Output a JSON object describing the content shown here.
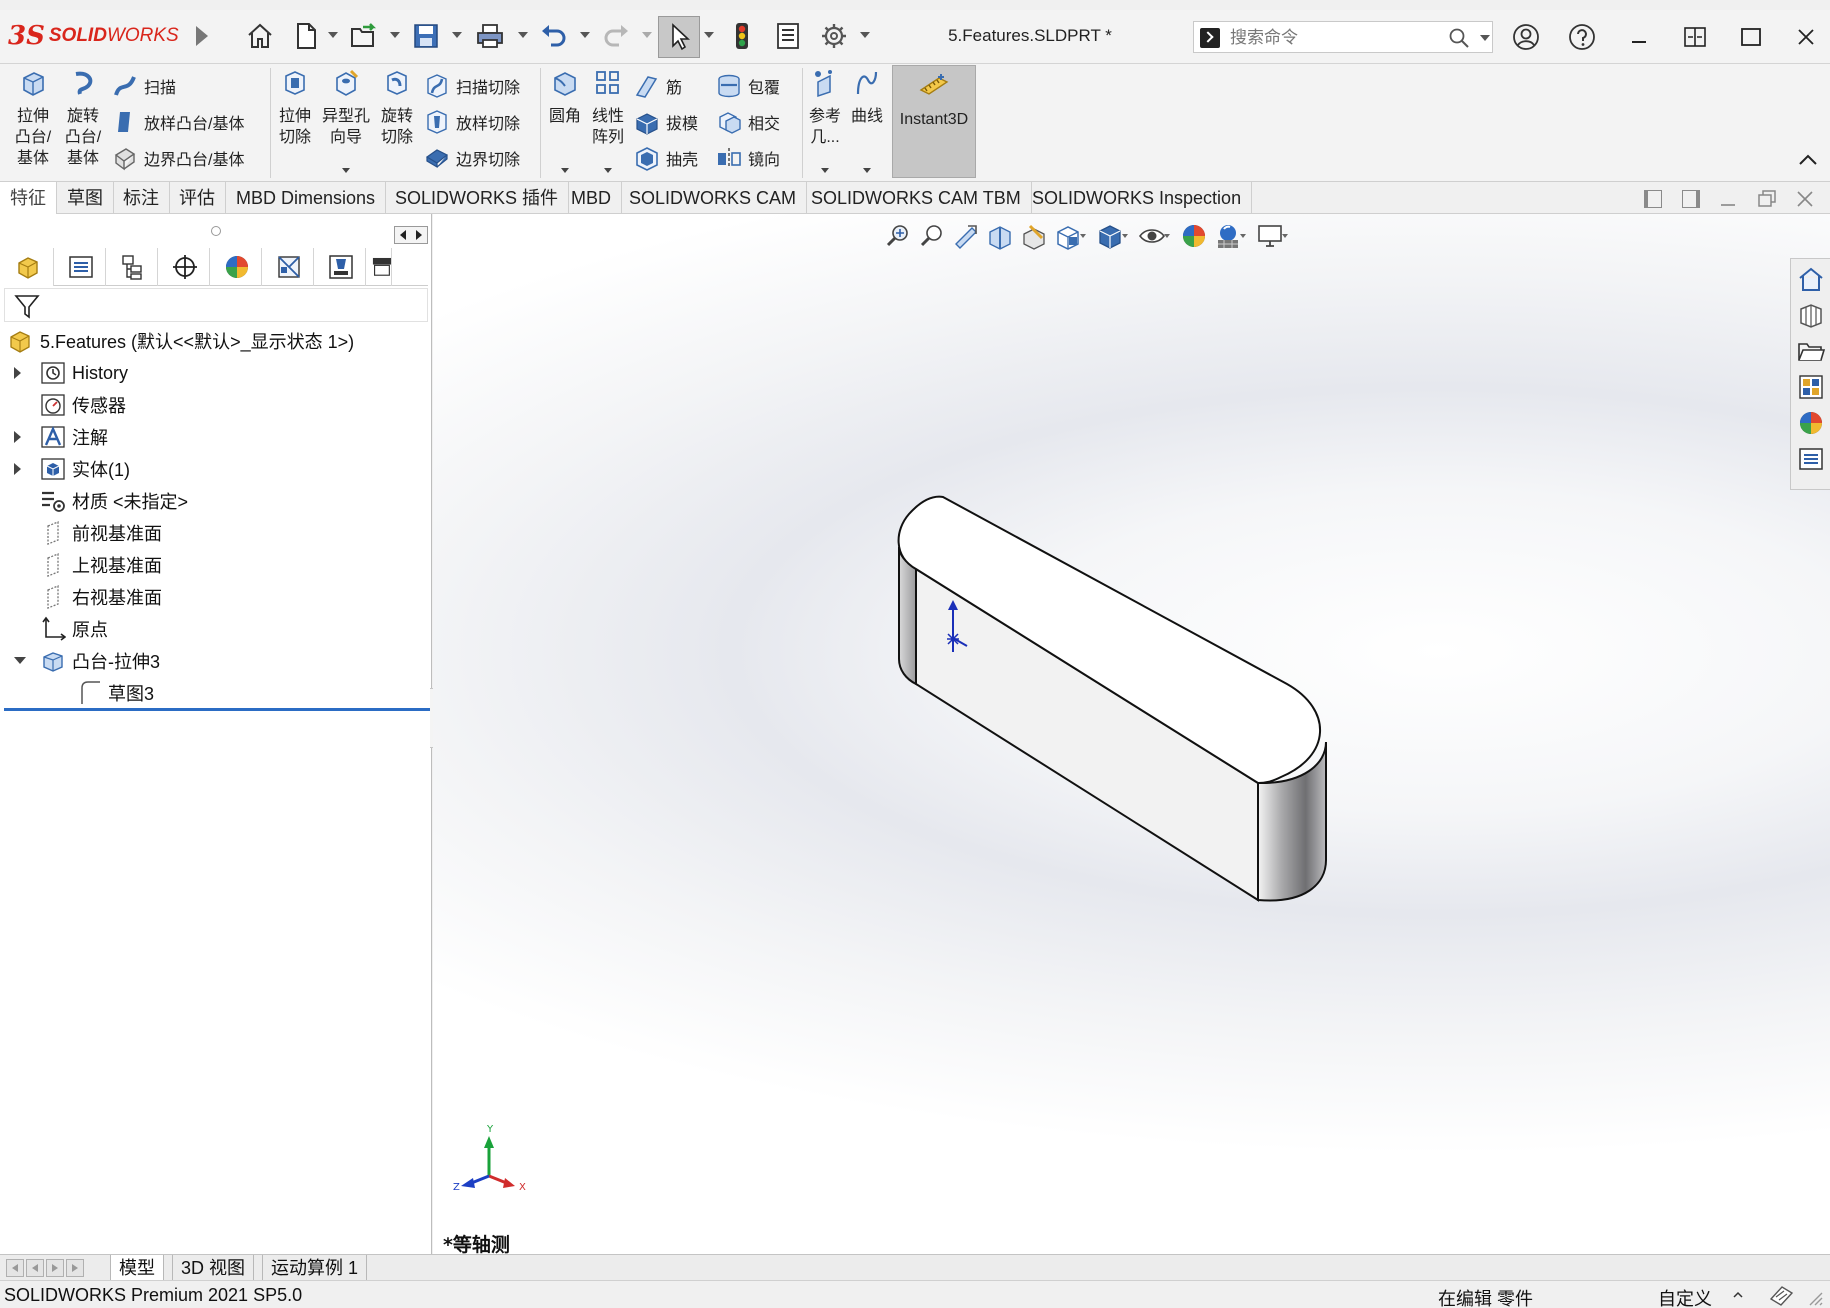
{
  "app": {
    "logo_ds": "3S",
    "logo_solid": "SOLID",
    "logo_works": "WORKS",
    "document_title": "5.Features.SLDPRT *",
    "accent_color": "#d9261c"
  },
  "search": {
    "placeholder": "搜索命令"
  },
  "ribbon": {
    "extrude_boss": "拉伸\n凸台/\n基体",
    "revolve_boss": "旋转\n凸台/\n基体",
    "sweep": "扫描",
    "loft_boss": "放样凸台/基体",
    "boundary_boss": "边界凸台/基体",
    "extrude_cut": "拉伸\n切除",
    "hole_wizard": "异型孔\n向导",
    "revolve_cut": "旋转\n切除",
    "sweep_cut": "扫描切除",
    "loft_cut": "放样切除",
    "boundary_cut": "边界切除",
    "fillet": "圆角",
    "linear_pattern": "线性\n阵列",
    "rib": "筋",
    "draft": "拔模",
    "shell": "抽壳",
    "wrap": "包覆",
    "intersect": "相交",
    "mirror": "镜向",
    "reference_geometry": "参考\n几...",
    "curves": "曲线",
    "instant3d": "Instant3D"
  },
  "command_tabs": [
    "特征",
    "草图",
    "标注",
    "评估",
    "MBD Dimensions",
    "SOLIDWORKS 插件",
    "MBD",
    "SOLIDWORKS CAM",
    "SOLIDWORKS CAM TBM",
    "SOLIDWORKS Inspection"
  ],
  "tree": {
    "root": "5.Features  (默认<<默认>_显示状态 1>)",
    "history": "History",
    "sensors": "传感器",
    "annotations": "注解",
    "solid_bodies": "实体(1)",
    "material": "材质 <未指定>",
    "front_plane": "前视基准面",
    "top_plane": "上视基准面",
    "right_plane": "右视基准面",
    "origin": "原点",
    "boss_extrude": "凸台-拉伸3",
    "sketch": "草图3"
  },
  "viewport": {
    "view_label": "*等轴测",
    "triad_x": "X",
    "triad_y": "Y",
    "triad_z": "Z"
  },
  "bottom_tabs": [
    "模型",
    "3D 视图",
    "运动算例 1"
  ],
  "status": {
    "product": "SOLIDWORKS Premium 2021 SP5.0",
    "mode": "在编辑 零件",
    "units": "自定义"
  }
}
